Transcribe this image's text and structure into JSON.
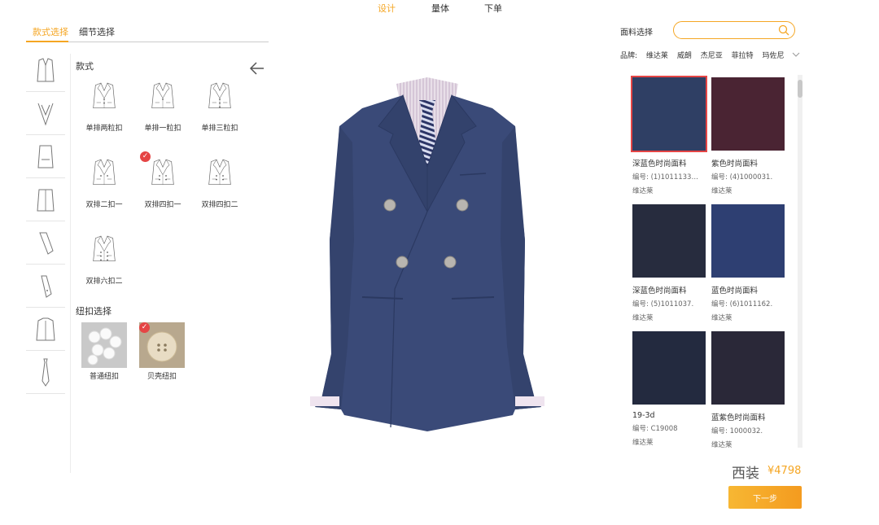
{
  "top_nav": [
    "设计",
    "量体",
    "下单"
  ],
  "left_tabs": [
    "款式选择",
    "细节选择"
  ],
  "style_section": {
    "title": "款式"
  },
  "styles": [
    {
      "label": "单排两粒扣",
      "selected": false,
      "buttons": 2,
      "double": false
    },
    {
      "label": "单排一粒扣",
      "selected": false,
      "buttons": 1,
      "double": false
    },
    {
      "label": "单排三粒扣",
      "selected": false,
      "buttons": 3,
      "double": false
    },
    {
      "label": "双排二扣一",
      "selected": false,
      "buttons": 2,
      "double": true
    },
    {
      "label": "双排四扣一",
      "selected": true,
      "buttons": 4,
      "double": true
    },
    {
      "label": "双排四扣二",
      "selected": false,
      "buttons": 4,
      "double": true
    },
    {
      "label": "双排六扣二",
      "selected": false,
      "buttons": 6,
      "double": true
    }
  ],
  "button_section": {
    "title": "纽扣选择"
  },
  "button_types": [
    {
      "label": "普通纽扣",
      "selected": false
    },
    {
      "label": "贝壳纽扣",
      "selected": true
    }
  ],
  "fabric_panel": {
    "title": "面料选择",
    "search_placeholder": "",
    "brand_label": "品牌:",
    "brands": [
      "维达莱",
      "威朗",
      "杰尼亚",
      "菲拉特",
      "玛佐尼"
    ]
  },
  "fabrics": [
    {
      "name": "深蓝色时尚面料",
      "code": "编号: (1)1011133…",
      "brand": "维达莱",
      "color": "#2f3f64",
      "selected": true
    },
    {
      "name": "紫色时尚面料",
      "code": "编号: (4)1000031.",
      "brand": "维达莱",
      "color": "#4a2433",
      "selected": false
    },
    {
      "name": "深蓝色时尚面料",
      "code": "编号: (5)1011037.",
      "brand": "维达莱",
      "color": "#272c3e",
      "selected": false
    },
    {
      "name": "蓝色时尚面料",
      "code": "编号: (6)1011162.",
      "brand": "维达莱",
      "color": "#2e3f72",
      "selected": false
    },
    {
      "name": "19-3d",
      "code": "编号: C19008",
      "brand": "维达莱",
      "color": "#232a3f",
      "selected": false
    },
    {
      "name": "蓝紫色时尚面料",
      "code": "编号: 1000032.",
      "brand": "维达莱",
      "color": "#2a2838",
      "selected": false
    }
  ],
  "summary": {
    "product": "西装",
    "price": "¥4798",
    "next_label": "下一步"
  },
  "colors": {
    "accent": "#f5a623",
    "suit": "#3a4a78",
    "selected_border": "#e54545"
  },
  "icons": [
    "search-icon",
    "back-arrow-icon",
    "chevron-down-icon",
    "check-icon"
  ]
}
